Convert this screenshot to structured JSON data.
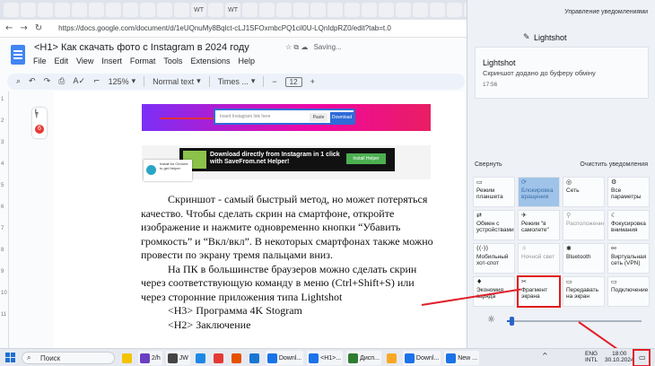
{
  "browser": {
    "tabs": [
      "",
      "",
      "",
      "",
      "",
      "",
      "",
      "",
      "",
      "",
      "",
      "WT",
      "",
      "WT",
      "",
      "",
      "",
      "",
      "",
      "",
      "",
      "",
      "",
      "",
      "",
      "",
      "",
      "",
      "",
      ""
    ],
    "active_tab_close": "×",
    "new_tab": "+",
    "url": "https://docs.google.com/document/d/1eUQnuMy8Bqlct-cLJ1SFOxmbcPQ1cil0U-LQnIdpRZ0/edit?tab=t.0"
  },
  "docs": {
    "title": "<H1> Как скачать фото с Instagram в 2024 году",
    "status_icons": "☆  ⧉  ☁",
    "saving": "Saving...",
    "menu": [
      "File",
      "Edit",
      "View",
      "Insert",
      "Format",
      "Tools",
      "Extensions",
      "Help"
    ],
    "toolbar": {
      "zoom": "125%",
      "style": "Normal text",
      "font": "Times ...",
      "font_size": "12",
      "minus": "−",
      "plus": "+"
    },
    "side_widget_badge": "6",
    "ruler_numbers": [
      "1",
      "2",
      "3",
      "4",
      "5",
      "6",
      "7",
      "8",
      "9",
      "10",
      "11"
    ],
    "embedded1": {
      "placeholder": "Insert Instagram link here",
      "paste": "Paste",
      "download": "Download"
    },
    "embedded2": {
      "headline": "Download directly from Instagram in 1 click with SaveFrom.net Helper!",
      "button": "Install Helper",
      "popup": "Install for Chrome to get Helper"
    },
    "paragraphs": [
      "Скриншот - самый быстрый метод, но может потеряться качество. Чтобы сделать скрин на смартфоне, откройте изображение и нажмите одновременно кнопки “Убавить громкость” и “Вкл/вкл”. В некоторых смартфонах также можно провести по экрану тремя пальцами вниз.",
      "На ПК в большинстве браузеров можно сделать скрин через соответствующую команду в меню (Ctrl+Shift+S) или через сторонние приложения типа Lightshot",
      "<H3> Программа 4K Stogram",
      "<H2> Заключение"
    ]
  },
  "notifications": {
    "header": "Управление уведомлениями",
    "app_name": "Lightshot",
    "card": {
      "title": "Lightshot",
      "message": "Скриншот додано до буферу обміну",
      "time": "17:56"
    },
    "collapse": "Свернуть",
    "clear_all": "Очистить уведомления",
    "tiles": [
      {
        "label": "Режим планшета",
        "icon": "▭",
        "state": "normal"
      },
      {
        "label": "Блокировка вращения",
        "icon": "⟳",
        "state": "on"
      },
      {
        "label": "Сеть",
        "icon": "◎",
        "state": "normal"
      },
      {
        "label": "Все параметры",
        "icon": "⚙",
        "state": "normal"
      },
      {
        "label": "Обмен с устройствами",
        "icon": "⇄",
        "state": "normal"
      },
      {
        "label": "Режим \"в самолете\"",
        "icon": "✈",
        "state": "normal"
      },
      {
        "label": "Расположение",
        "icon": "⚲",
        "state": "dim"
      },
      {
        "label": "Фокусировка внимания",
        "icon": "☾",
        "state": "normal"
      },
      {
        "label": "Мобильный хот-спот",
        "icon": "((·))",
        "state": "normal"
      },
      {
        "label": "Ночной свет",
        "icon": "☼",
        "state": "dim"
      },
      {
        "label": "Bluetooth",
        "icon": "✱",
        "state": "normal"
      },
      {
        "label": "Виртуальная сеть (VPN)",
        "icon": "⚯",
        "state": "normal"
      },
      {
        "label": "Экономия заряда",
        "icon": "♦",
        "state": "normal"
      },
      {
        "label": "Фрагмент экрана",
        "icon": "✂",
        "state": "highlight"
      },
      {
        "label": "Передавать на экран",
        "icon": "▭",
        "state": "normal"
      },
      {
        "label": "Подключение",
        "icon": "▭",
        "state": "normal"
      }
    ],
    "brightness_level": 0.02
  },
  "taskbar": {
    "search_label": "Поиск",
    "apps": [
      {
        "label": "",
        "color": "#f3c200"
      },
      {
        "label": "2/h",
        "color": "#6a3fc1"
      },
      {
        "label": "JW",
        "color": "#444"
      },
      {
        "label": "",
        "color": "#1e88e5"
      },
      {
        "label": "",
        "color": "#e53935"
      },
      {
        "label": "",
        "color": "#e65100"
      },
      {
        "label": "",
        "color": "#1976d2"
      },
      {
        "label": "Downl...",
        "color": "#1a73e8"
      },
      {
        "label": "<H1>...",
        "color": "#1a73e8"
      },
      {
        "label": "Дисп...",
        "color": "#2e7d32"
      },
      {
        "label": "",
        "color": "#f9a825"
      },
      {
        "label": "Downl...",
        "color": "#1a73e8"
      },
      {
        "label": "New ...",
        "color": "#1a73e8"
      }
    ],
    "tray_chevron": "^",
    "lang_top": "ENG",
    "lang_bottom": "INTL",
    "time": "18:00",
    "date": "30.10.2024",
    "notif_icon": "▭"
  }
}
